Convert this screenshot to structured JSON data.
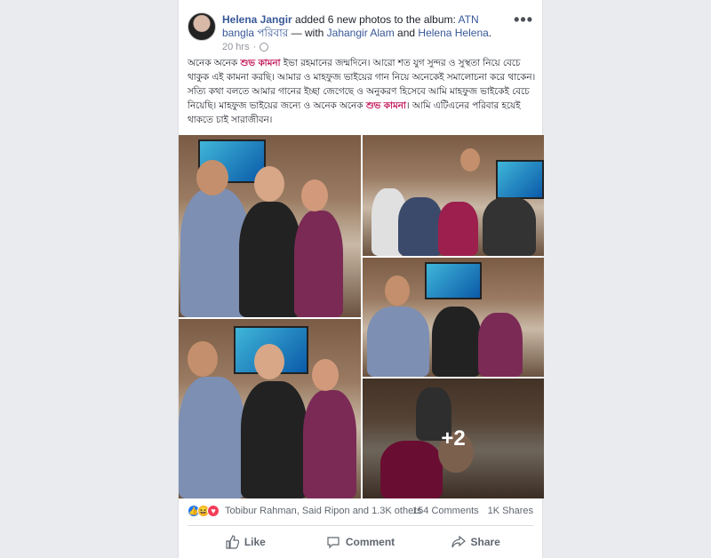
{
  "post": {
    "author": "Helena Jangir",
    "action_text": " added 6 new photos to the album: ",
    "album": "ATN bangla পরিবার",
    "with_text": " — with ",
    "tagged_1": "Jahangir Alam",
    "and_text": " and ",
    "tagged_2": "Helena Helena",
    "end_text": ".",
    "time": "20 hrs",
    "more_label": "•••"
  },
  "body": {
    "part1": "অনেক অনেক ",
    "hl1": "শুভ কামনা",
    "part2": " ইভা রহমানের জন্মদিনে। আরো শত যুগ সুন্দর ও সুস্থতা নিয়ে বেচে থাকুক এই কামনা করছি। আমার ও মাহফুজ ভাইয়ের গান নিয়ে অনেকেই সমালোচনা করে থাকেন। সত্যি কথা বলতে আমার গানের ইচ্ছা জেগেছে ও অনুকরণ হিসেবে আমি মাহফুজ ভাইকেই বেচে নিয়েছি। মাহফুজ ভাইয়ের জন্যে ও অনেক অনেক ",
    "hl2": "শুভ কামনা",
    "part3": "। আমি এটিএনের পরিবার হয়েই থাকতে চাই সারাজীবন।"
  },
  "photos": {
    "more_count": "+2"
  },
  "stats": {
    "reaction_names": "Tobibur Rahman, Said Ripon and 1.3K others",
    "comments": "154 Comments",
    "shares": "1K Shares"
  },
  "actions": {
    "like": "Like",
    "comment": "Comment",
    "share": "Share"
  },
  "colors": {
    "link": "#385898",
    "highlight": "#c2185b",
    "like_blue": "#2078f4"
  }
}
